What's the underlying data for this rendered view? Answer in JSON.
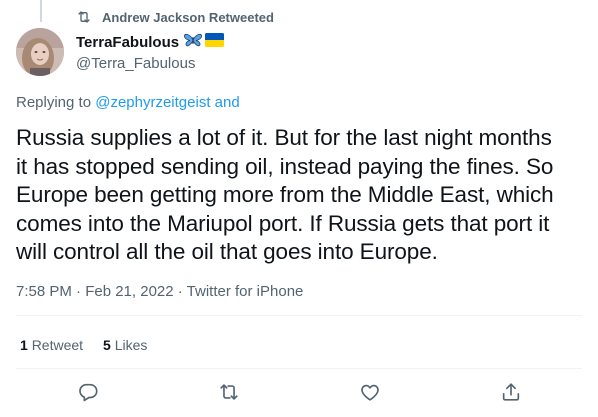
{
  "retweet_context": {
    "text": "Andrew Jackson Retweeted",
    "icon": "retweet-icon"
  },
  "author": {
    "display_name": "TerraFabulous",
    "badges": [
      "butterfly-emoji",
      "ukraine-flag-emoji"
    ],
    "handle": "@Terra_Fabulous"
  },
  "reply": {
    "prefix": "Replying to ",
    "mention": "@zephyrzeitgeist",
    "suffix": " and"
  },
  "tweet": {
    "text": "Russia supplies a lot of it. But for the last night months\nit has stopped sending oil, instead paying the fines. So\nEurope been getting more from the Middle East, which\ncomes into the Mariupol port. If Russia gets that port it\nwill control all the oil that goes into Europe.",
    "timestamp": "7:58 PM · Feb 21, 2022 · Twitter for iPhone"
  },
  "stats": {
    "retweets_count": "1",
    "retweets_label": "Retweet",
    "likes_count": "5",
    "likes_label": "Likes"
  },
  "actions": [
    {
      "name": "reply",
      "icon": "reply-icon"
    },
    {
      "name": "retweet",
      "icon": "retweet-icon"
    },
    {
      "name": "like",
      "icon": "heart-icon"
    },
    {
      "name": "share",
      "icon": "share-icon"
    }
  ],
  "colors": {
    "text_primary": "#0f1419",
    "text_secondary": "#536471",
    "link": "#1d9bf0",
    "divider": "#eff3f4",
    "butterfly": "#4a90e2",
    "flag_blue": "#0057b7",
    "flag_yellow": "#ffd700"
  }
}
